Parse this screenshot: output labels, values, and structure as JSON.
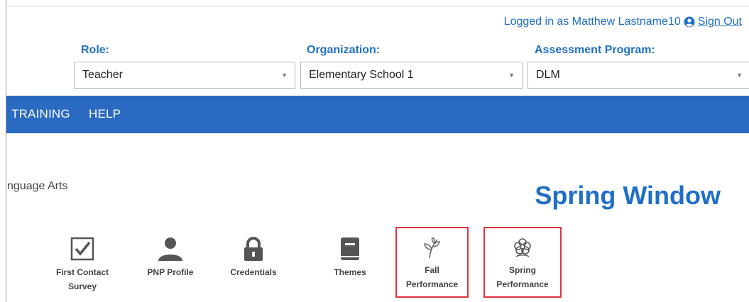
{
  "header": {
    "logged_in_text": "Logged in as Matthew Lastname10",
    "sign_out_label": "Sign Out"
  },
  "filters": {
    "role": {
      "label": "Role:",
      "value": "Teacher"
    },
    "organization": {
      "label": "Organization:",
      "value": "Elementary School 1"
    },
    "assessment_program": {
      "label": "Assessment Program:",
      "value": "DLM"
    }
  },
  "nav": {
    "items": [
      {
        "label": "TRAINING"
      },
      {
        "label": "HELP"
      }
    ]
  },
  "main": {
    "subject_text": "nguage Arts",
    "window_title": "Spring Window"
  },
  "tools": [
    {
      "name": "first-contact-survey",
      "line1": "First Contact",
      "line2": "Survey",
      "icon": "checkbox-icon"
    },
    {
      "name": "pnp-profile",
      "line1": "PNP Profile",
      "line2": "",
      "icon": "person-icon"
    },
    {
      "name": "credentials",
      "line1": "Credentials",
      "line2": "",
      "icon": "lock-icon"
    },
    {
      "name": "themes",
      "line1": "Themes",
      "line2": "",
      "icon": "book-icon"
    },
    {
      "name": "fall-performance",
      "line1": "Fall",
      "line2": "Performance",
      "icon": "leaf-icon",
      "highlighted": true
    },
    {
      "name": "spring-performance",
      "line1": "Spring",
      "line2": "Performance",
      "icon": "flower-icon",
      "highlighted": true
    }
  ],
  "colors": {
    "accent_blue": "#1f6fc6",
    "nav_bar": "#2a6ac0",
    "highlight_red": "#e0343b",
    "icon_gray": "#555555"
  }
}
